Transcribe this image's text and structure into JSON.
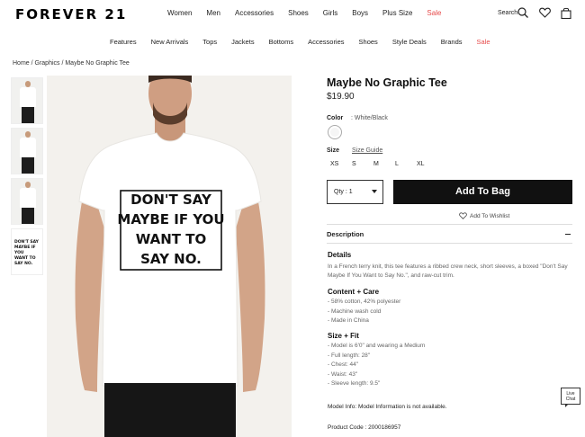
{
  "header": {
    "logo": "FOREVER 21",
    "nav": [
      "Women",
      "Men",
      "Accessories",
      "Shoes",
      "Girls",
      "Boys",
      "Plus Size",
      "Sale"
    ],
    "search_label": "Search"
  },
  "subnav": [
    "Features",
    "New Arrivals",
    "Tops",
    "Jackets",
    "Bottoms",
    "Accessories",
    "Shoes",
    "Style Deals",
    "Brands",
    "Sale"
  ],
  "breadcrumb": "Home / Graphics / Maybe No Graphic Tee",
  "product": {
    "title": "Maybe No Graphic Tee",
    "price": "$19.90",
    "color_label": "Color",
    "color_value": ": White/Black",
    "size_label": "Size",
    "size_guide": "Size Guide",
    "sizes": [
      "XS",
      "S",
      "M",
      "L",
      "XL"
    ],
    "qty_label": "Qty : 1",
    "add_to_bag": "Add To Bag",
    "wishlist": "Add To Wishlist",
    "shirt_print": [
      "DON'T SAY",
      "MAYBE IF YOU",
      "WANT TO",
      "SAY NO."
    ]
  },
  "description": {
    "header": "Description",
    "details_title": "Details",
    "details_text": "In a French terry knit, this tee features a ribbed crew neck, short sleeves, a boxed \"Don't Say Maybe If You Want to Say No.\", and raw-cut trim.",
    "content_title": "Content + Care",
    "content_items": [
      "- 58% cotton, 42% polyester",
      "- Machine wash cold",
      "- Made in China"
    ],
    "fit_title": "Size + Fit",
    "fit_items": [
      "- Model is 6'0\" and wearing a Medium",
      "- Full length: 28\"",
      "- Chest: 44\"",
      "- Waist: 43\"",
      "- Sleeve length: 9.5\""
    ],
    "model_info": "Model Info: Model Information is not available.",
    "product_code": "Product Code : 2000186957"
  },
  "live_chat": [
    "Live",
    "Chat"
  ],
  "colors": {
    "sale": "#e64a4a",
    "button": "#111111"
  }
}
